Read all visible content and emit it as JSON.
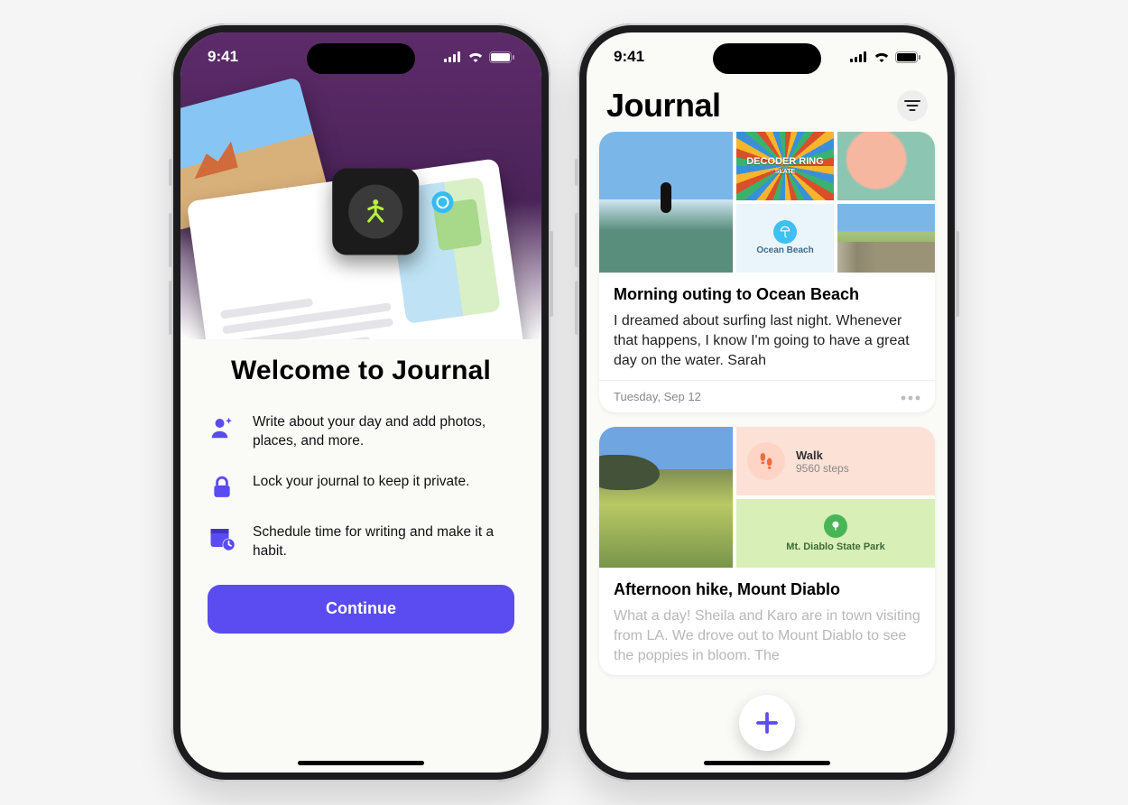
{
  "status_bar": {
    "time": "9:41"
  },
  "onboarding": {
    "title": "Welcome to Journal",
    "features": [
      {
        "text": "Write about your day and add photos, places, and more."
      },
      {
        "text": "Lock your journal to keep it private."
      },
      {
        "text": "Schedule time for writing and make it a habit."
      }
    ],
    "cta": "Continue"
  },
  "journal": {
    "title": "Journal",
    "entries": [
      {
        "title": "Morning outing to Ocean Beach",
        "body": "I dreamed about surfing last night. Whenever that happens, I know I'm going to have a great day on the water. Sarah",
        "date": "Tuesday, Sep 12",
        "map_caption": "Ocean Beach",
        "podcast_title": "DECODER RING",
        "podcast_source": "SLATE"
      },
      {
        "title": "Afternoon hike, Mount Diablo",
        "body": "What a day! Sheila and Karo are in town visiting from LA. We drove out to Mount Diablo to see the poppies in bloom. The",
        "walk_label": "Walk",
        "walk_value": "9560 steps",
        "map_caption": "Mt. Diablo State Park"
      }
    ]
  }
}
